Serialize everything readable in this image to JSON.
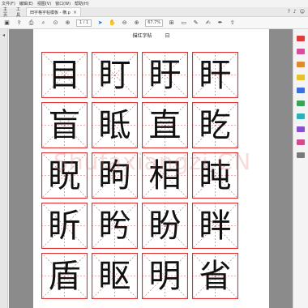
{
  "menu": [
    "文件(F)",
    "编辑(E)",
    "视图(V)",
    "窗口(W)",
    "帮助(H)"
  ],
  "tabs": {
    "home": "主页",
    "tools": "工具",
    "doc": "田字格字帖模板 - 横.pdf"
  },
  "toolbar": {
    "page_indicator": "1 / 1",
    "zoom_level": "67.7%"
  },
  "page_header": {
    "title": "描红字帖",
    "subtitle": "日"
  },
  "watermark": "Shufaxiangzi.CN",
  "grid": {
    "line_color": "#e03030",
    "rows": [
      [
        "目",
        "盯",
        "盱",
        "盰"
      ],
      [
        "盲",
        "眡",
        "直",
        "盵"
      ],
      [
        "眖",
        "眗",
        "相",
        "盹"
      ],
      [
        "盺",
        "盻",
        "盼",
        "眫"
      ],
      [
        "盾",
        "眍",
        "明",
        "省"
      ]
    ]
  }
}
